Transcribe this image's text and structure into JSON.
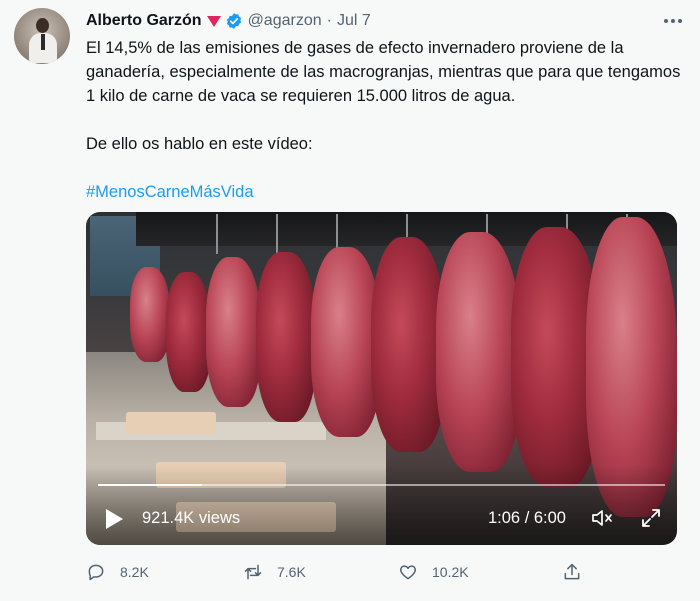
{
  "tweet": {
    "author_name": "Alberto Garzón",
    "handle": "@agarzon",
    "separator": "·",
    "date": "Jul 7",
    "text_paragraph_1": "El 14,5% de las emisiones de gases de efecto invernadero proviene de la ganadería, especialmente de las macrogranjas, mientras que para que tengamos 1 kilo de carne de vaca se requieren 15.000 litros de agua.",
    "text_paragraph_2": "De ello os hablo en este vídeo:",
    "hashtag": "#MenosCarneMásVida"
  },
  "video": {
    "views": "921.4K views",
    "time": "1:06 / 6:00",
    "progress_fraction": 0.183
  },
  "actions": {
    "replies": "8.2K",
    "retweets": "7.6K",
    "likes": "10.2K"
  },
  "colors": {
    "accent": "#1d9bf0",
    "flag": "#e0245e",
    "secondary_text": "#536471",
    "background": "#f7f9f9"
  },
  "icons": [
    "flag-icon",
    "verified-icon",
    "more-icon",
    "play-icon",
    "volume-icon",
    "expand-icon",
    "reply-icon",
    "retweet-icon",
    "like-icon",
    "share-icon"
  ]
}
